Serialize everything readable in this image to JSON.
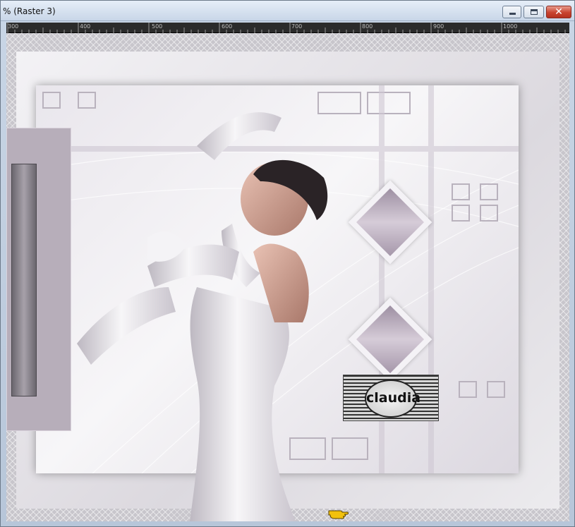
{
  "window": {
    "title": "% (Raster 3)",
    "close_glyph": "✕"
  },
  "ruler": {
    "labels": [
      "300",
      "400",
      "500",
      "600",
      "700",
      "800",
      "900",
      "1000"
    ]
  },
  "canvas": {
    "watermark_text": "claudia"
  },
  "icons": {
    "minimize": "minimize-icon",
    "maximize": "maximize-icon",
    "close": "close-icon",
    "cursor": "pointing-hand-cursor-icon"
  },
  "colors": {
    "titlebar": "#c8d6e8",
    "close_button": "#c8432f",
    "ruler_bg": "#2b2b2b",
    "frame": "#dcd9df",
    "accent_mauve": "#b7aeba",
    "cursor": "#f2c10d"
  }
}
